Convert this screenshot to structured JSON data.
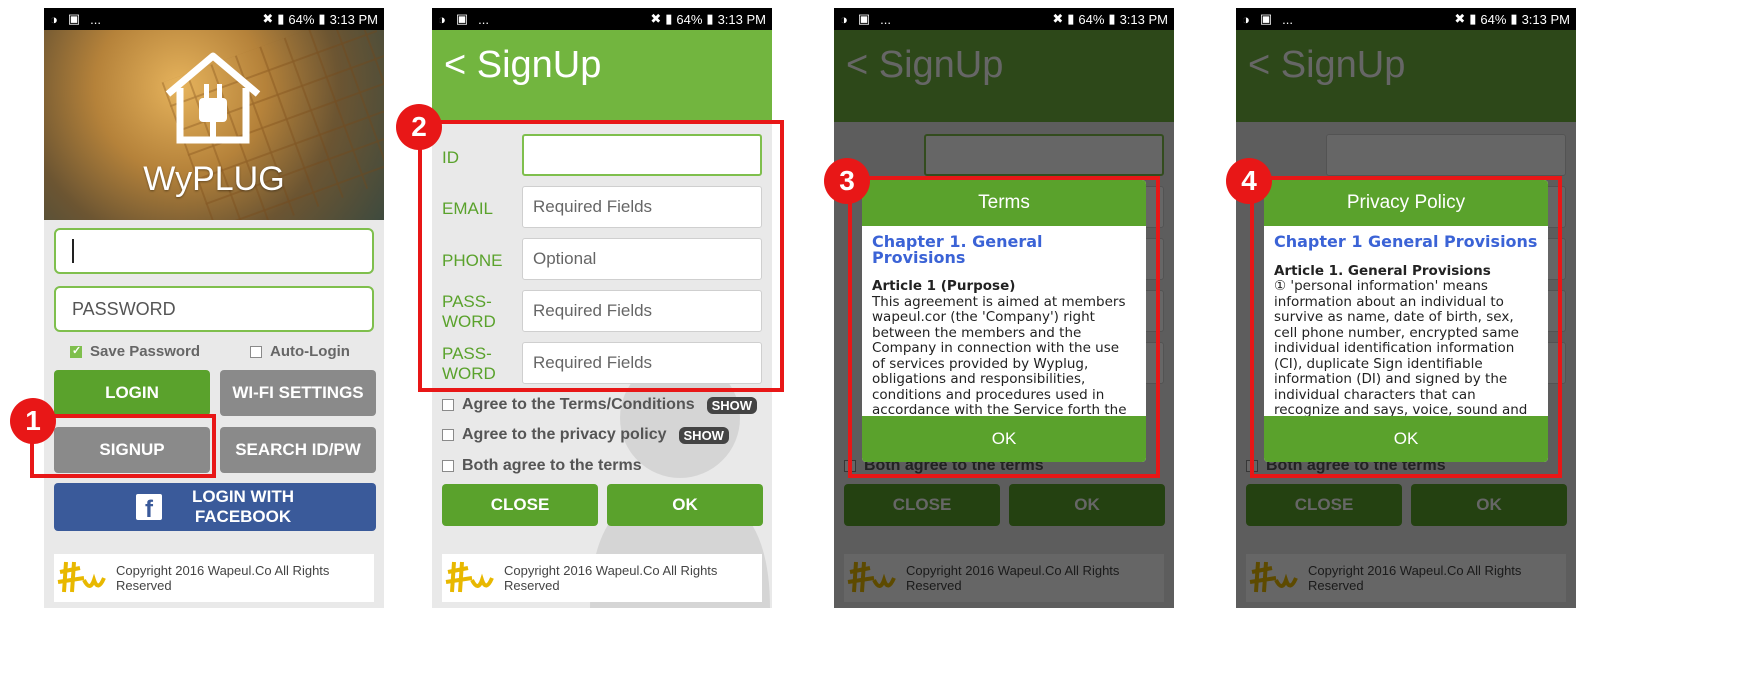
{
  "status_bar": {
    "battery": "64%",
    "time": "3:13 PM",
    "more": "..."
  },
  "login": {
    "brand": "WyPLUG",
    "password_placeholder": "PASSWORD",
    "save_password_label": "Save Password",
    "auto_login_label": "Auto-Login",
    "login_button": "LOGIN",
    "wifi_button": "WI-FI SETTINGS",
    "signup_button": "SIGNUP",
    "search_button": "SEARCH ID/PW",
    "facebook_button_line1": "LOGIN WITH",
    "facebook_button_line2": "FACEBOOK"
  },
  "footer": {
    "copyright": "Copyright 2016 Wapeul.Co All Rights Reserved"
  },
  "signup": {
    "title": "< SignUp",
    "fields": [
      {
        "label": "ID",
        "placeholder": ""
      },
      {
        "label": "EMAIL",
        "placeholder": "Required Fields"
      },
      {
        "label": "PHONE",
        "placeholder": "Optional"
      },
      {
        "label": "PASS-\nWORD",
        "placeholder": "Required Fields"
      },
      {
        "label": "PASS-\nWORD",
        "placeholder": "Required Fields"
      }
    ],
    "agree_terms": "Agree to the Terms/Conditions",
    "agree_privacy": "Agree to the privacy policy",
    "agree_both": "Both agree to the terms",
    "show_label": "SHOW",
    "close_button": "CLOSE",
    "ok_button": "OK"
  },
  "terms_dialog": {
    "title": "Terms",
    "chapter": "Chapter 1. General Provisions",
    "article": "Article 1 (Purpose)",
    "body": "This agreement is aimed at members wapeul.cor (the 'Company') right between the members and the Company in connection with the use of services provided by Wyplug, obligations and responsibilities, conditions and procedures used in accordance with the Service forth the basics The by.",
    "ok": "OK"
  },
  "privacy_dialog": {
    "title": "Privacy Policy",
    "chapter": "Chapter 1 General Provisions",
    "article": "Article 1. General Provisions",
    "body": "① 'personal information' means information about an individual to survive as name, date of birth, sex, cell phone number, encrypted same individual identification information (CI), duplicate Sign identifiable information (DI) and signed by the individual characters that can recognize and says, voice, sound and",
    "ok": "OK"
  },
  "callouts": [
    "1",
    "2",
    "3",
    "4"
  ],
  "colors": {
    "green": "#5aa22c",
    "appbar": "#72b53f",
    "red": "#e81717",
    "facebook": "#3a5a9a",
    "link_blue": "#3b63d6"
  }
}
